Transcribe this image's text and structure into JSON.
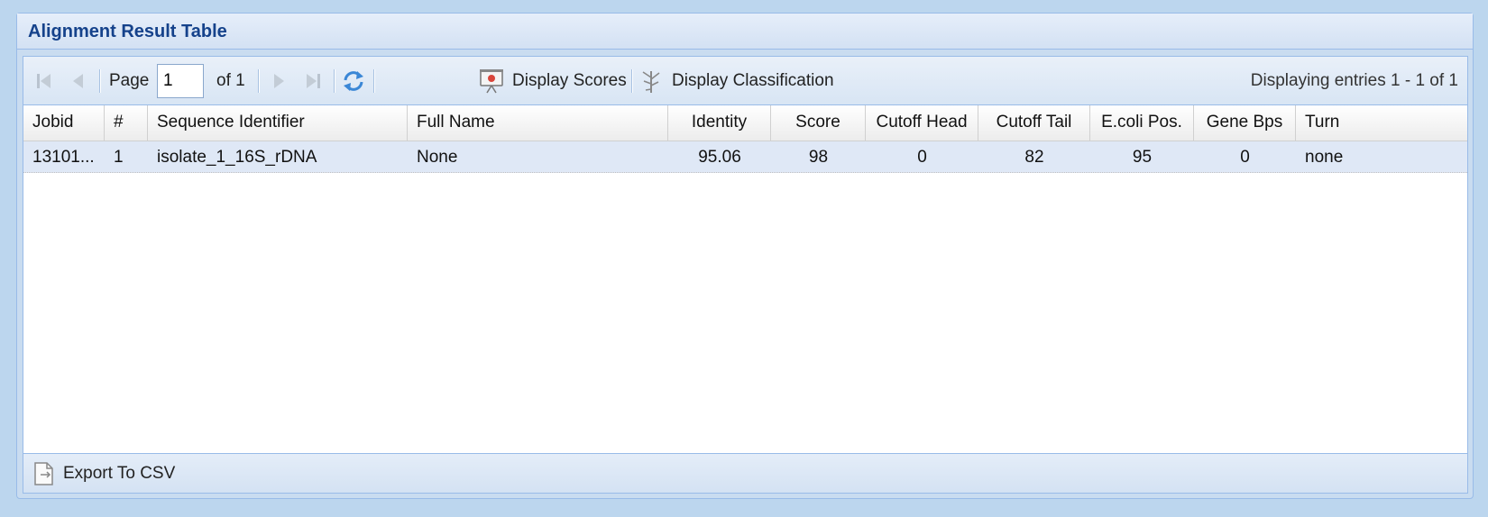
{
  "panel": {
    "title": "Alignment Result Table"
  },
  "paging": {
    "page_label": "Page",
    "page_value": "1",
    "of_label": "of 1",
    "display_scores_label": "Display Scores",
    "display_classification_label": "Display Classification",
    "entries_text": "Displaying entries 1 - 1 of 1"
  },
  "columns": [
    "Jobid",
    "#",
    "Sequence Identifier",
    "Full Name",
    "Identity",
    "Score",
    "Cutoff Head",
    "Cutoff Tail",
    "E.coli Pos.",
    "Gene Bps",
    "Turn"
  ],
  "rows": [
    [
      "13101...",
      "1",
      "isolate_1_16S_rDNA",
      "None",
      "95.06",
      "98",
      "0",
      "82",
      "95",
      "0",
      "none"
    ]
  ],
  "footer": {
    "export_label": "Export To CSV"
  },
  "colors": {
    "accent": "#15428b",
    "border": "#99bbe8",
    "row_selected": "#dfe8f6"
  }
}
